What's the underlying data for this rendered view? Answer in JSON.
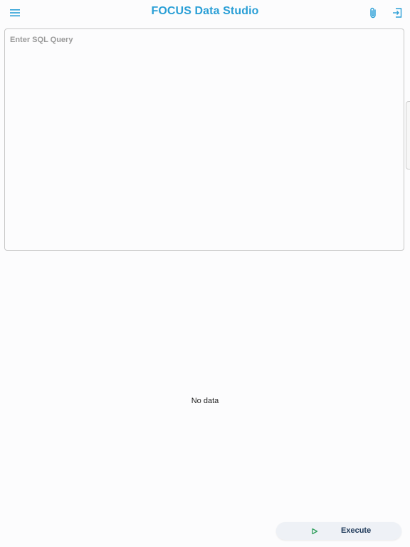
{
  "header": {
    "title": "FOCUS Data Studio",
    "menu_icon": "hamburger-menu-icon",
    "attach_icon": "paperclip-icon",
    "logout_icon": "logout-icon",
    "accent_color": "#2a9fd6"
  },
  "query": {
    "placeholder": "Enter SQL Query",
    "value": ""
  },
  "results": {
    "empty_text": "No data"
  },
  "actions": {
    "execute_label": "Execute",
    "execute_icon": "play-icon",
    "execute_icon_color": "#2e9e5b"
  }
}
